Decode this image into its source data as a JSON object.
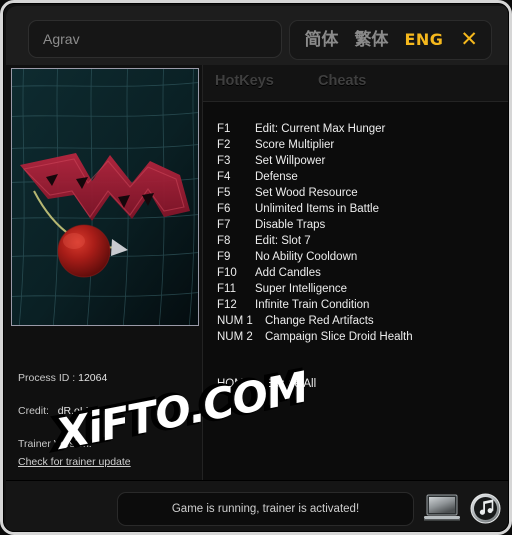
{
  "window": {
    "accent_gold": "#f5b81d",
    "frame_color": "#d6d6d6",
    "background": "#0d0d0d"
  },
  "header": {
    "search": {
      "value": "",
      "placeholder": "Agrav"
    },
    "languages": [
      {
        "label": "简体",
        "active": false
      },
      {
        "label": "繁体",
        "active": false
      },
      {
        "label": "ENG",
        "active": true
      }
    ],
    "close_label": "✕"
  },
  "left_panel": {
    "art_name": "game-cover-art",
    "process_id_label": "Process ID :",
    "process_id_value": "12064",
    "credit_label": "Credit:",
    "credit_value": "dR.oLLe",
    "trainer_version_label": "Trainer Version:",
    "update_link": "Check for trainer update"
  },
  "tabs": [
    {
      "label": "HotKeys",
      "active": true
    },
    {
      "label": "Cheats",
      "active": false
    }
  ],
  "hotkeys": [
    {
      "key": "F1",
      "label": "Edit: Current Max Hunger"
    },
    {
      "key": "F2",
      "label": "Score Multiplier"
    },
    {
      "key": "F3",
      "label": "Set Willpower"
    },
    {
      "key": "F4",
      "label": "Defense"
    },
    {
      "key": "F5",
      "label": "Set Wood Resource"
    },
    {
      "key": "F6",
      "label": "Unlimited Items in Battle"
    },
    {
      "key": "F7",
      "label": "Disable Traps"
    },
    {
      "key": "F8",
      "label": "Edit: Slot 7"
    },
    {
      "key": "F9",
      "label": "No Ability Cooldown"
    },
    {
      "key": "F10",
      "label": "Add Candles"
    },
    {
      "key": "F11",
      "label": "Super Intelligence"
    },
    {
      "key": "F12",
      "label": "Infinite Train Condition"
    },
    {
      "key": "NUM 1",
      "label": "Change Red Artifacts"
    },
    {
      "key": "NUM 2",
      "label": "Campaign Slice Droid Health"
    }
  ],
  "enable_all": {
    "key": "HOME",
    "label": "Enable All"
  },
  "footer": {
    "status": "Game is running, trainer is activated!",
    "laptop_icon": "laptop-icon",
    "music_icon": "music-note-icon"
  },
  "watermark": {
    "text": "XiFTO.COM"
  }
}
